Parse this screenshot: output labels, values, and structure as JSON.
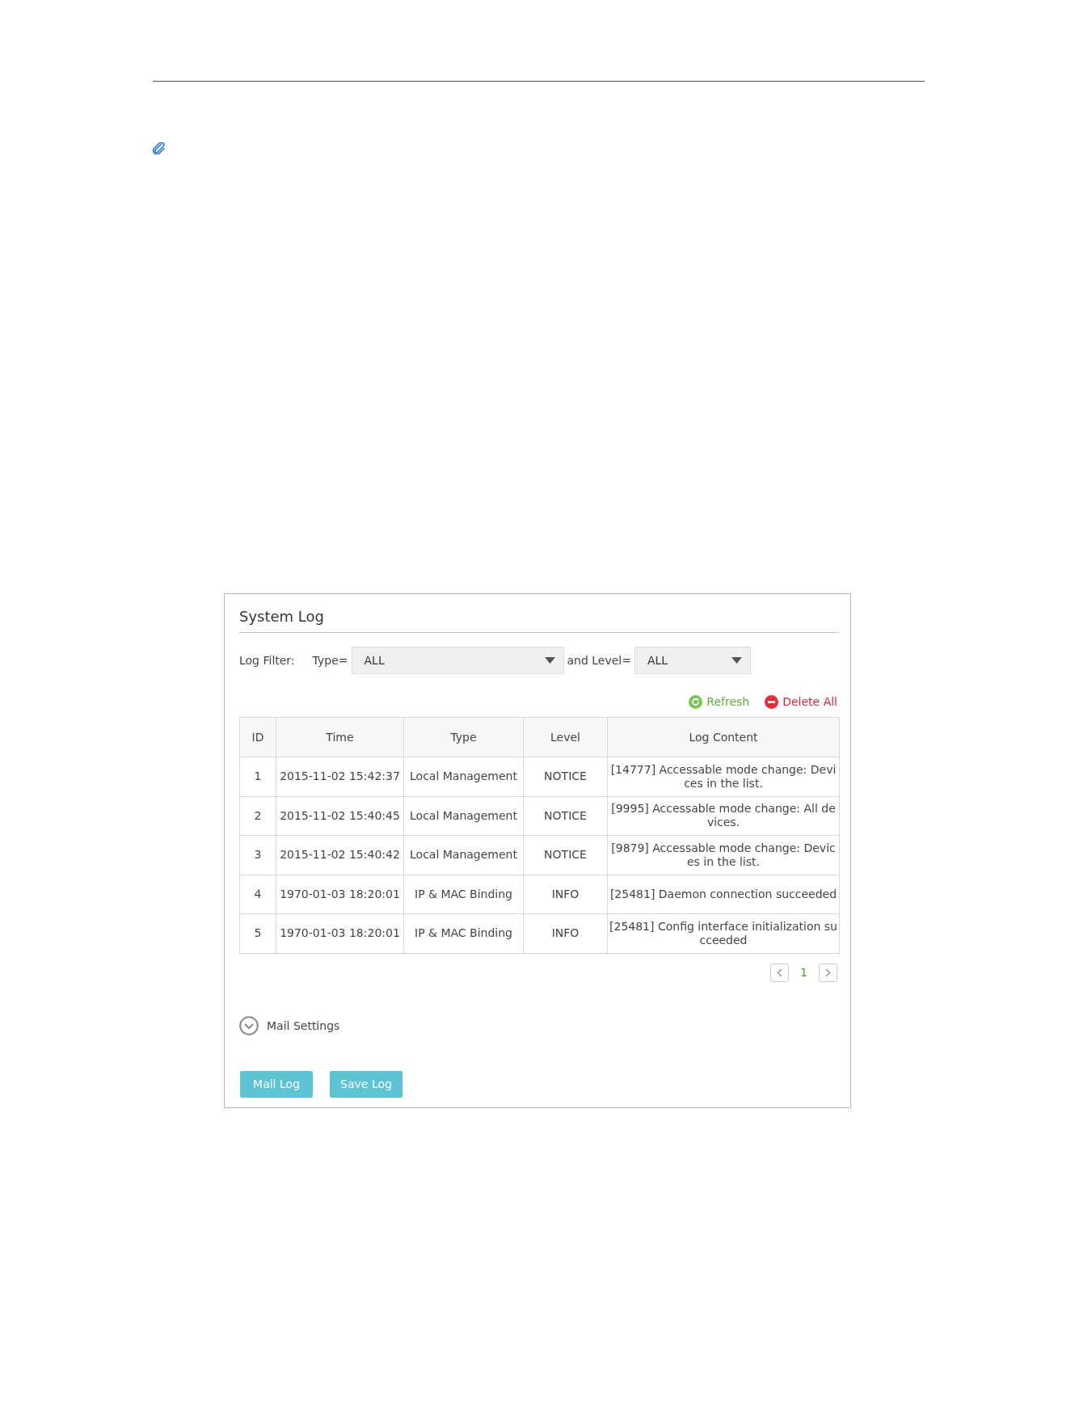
{
  "system_log": {
    "title": "System Log",
    "filter": {
      "label": "Log Filter:",
      "dropdowns": [
        {
          "label": "Type=",
          "value": "ALL"
        },
        {
          "label": "and Level=",
          "value": "ALL"
        }
      ]
    },
    "actions": [
      {
        "kind": "refresh",
        "label": "Refresh"
      },
      {
        "kind": "delete",
        "label": "Delete All"
      }
    ],
    "table": {
      "columns": [
        "ID",
        "Time",
        "Type",
        "Level",
        "Log Content"
      ],
      "rows": [
        [
          "1",
          "2015-11-02 15:42:37",
          "Local Management",
          "NOTICE",
          "[14777] Accessable mode change: Devices in the list."
        ],
        [
          "2",
          "2015-11-02 15:40:45",
          "Local Management",
          "NOTICE",
          "[9995] Accessable mode change: All devices."
        ],
        [
          "3",
          "2015-11-02 15:40:42",
          "Local Management",
          "NOTICE",
          "[9879] Accessable mode change: Devices in the list."
        ],
        [
          "4",
          "1970-01-03 18:20:01",
          "IP & MAC Binding",
          "INFO",
          "[25481] Daemon connection succeeded"
        ],
        [
          "5",
          "1970-01-03 18:20:01",
          "IP & MAC Binding",
          "INFO",
          "[25481] Config interface initialization succeeded"
        ]
      ]
    },
    "pagination": {
      "pages": [
        {
          "label": "1",
          "selected": true
        }
      ]
    },
    "mail_settings": {
      "label": "Mail Settings",
      "expanded": false
    },
    "buttons": [
      "Mail Log",
      "Save Log"
    ]
  }
}
